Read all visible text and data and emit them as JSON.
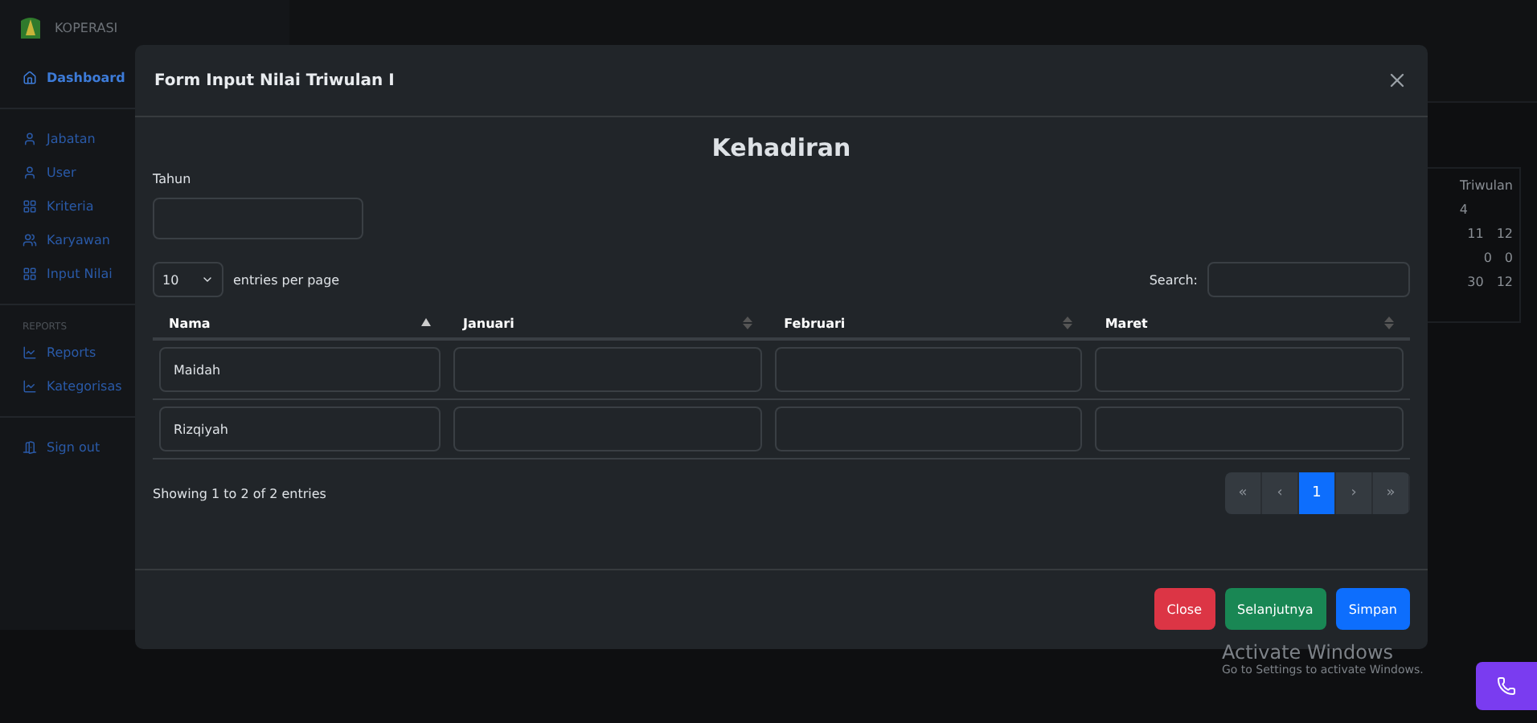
{
  "brand": {
    "name": "KOPERASI"
  },
  "sidebar": {
    "items": [
      {
        "label": "Dashboard",
        "selected": true
      },
      {
        "kind": "divider"
      },
      {
        "label": "Jabatan",
        "selected": false
      },
      {
        "label": "User",
        "selected": false
      },
      {
        "label": "Kriteria",
        "selected": false
      },
      {
        "label": "Karyawan",
        "selected": false
      },
      {
        "label": "Input Nilai",
        "selected": false
      },
      {
        "kind": "divider"
      },
      {
        "kind": "heading",
        "label": "REPORTS"
      },
      {
        "label": "Reports",
        "selected": false
      },
      {
        "label": "Kategorisas",
        "selected": false
      },
      {
        "kind": "divider"
      },
      {
        "label": "Sign out",
        "selected": false
      }
    ]
  },
  "background_table": {
    "header": "Triwulan",
    "subheader": "4",
    "rows": [
      [
        "11",
        "12"
      ],
      [
        "0",
        "0"
      ],
      [
        "30",
        "12"
      ]
    ]
  },
  "modal": {
    "title": "Form Input Nilai Triwulan I",
    "heading": "Kehadiran",
    "year_field": {
      "label": "Tahun"
    },
    "page_size": {
      "value": "10",
      "suffix": "entries per page"
    },
    "search": {
      "label": "Search:"
    },
    "columns": [
      {
        "label": "Nama",
        "sorted": true
      },
      {
        "label": "Januari",
        "sorted": false
      },
      {
        "label": "Februari",
        "sorted": false
      },
      {
        "label": "Maret",
        "sorted": false
      }
    ],
    "rows": [
      {
        "name": "Maidah"
      },
      {
        "name": "Rizqiyah"
      }
    ],
    "info": "Showing 1 to 2 of 2 entries",
    "pagination": [
      {
        "label": "«",
        "selected": false
      },
      {
        "label": "‹",
        "selected": false
      },
      {
        "label": "1",
        "selected": true
      },
      {
        "label": "›",
        "selected": false
      },
      {
        "label": "»",
        "selected": false
      }
    ],
    "buttons": [
      {
        "label": "Close",
        "kind": "danger"
      },
      {
        "label": "Selanjutnya",
        "kind": "success"
      },
      {
        "label": "Simpan",
        "kind": "primary"
      }
    ]
  },
  "os_notice": {
    "title": "Activate Windows",
    "subtitle": "Go to Settings to activate Windows."
  }
}
